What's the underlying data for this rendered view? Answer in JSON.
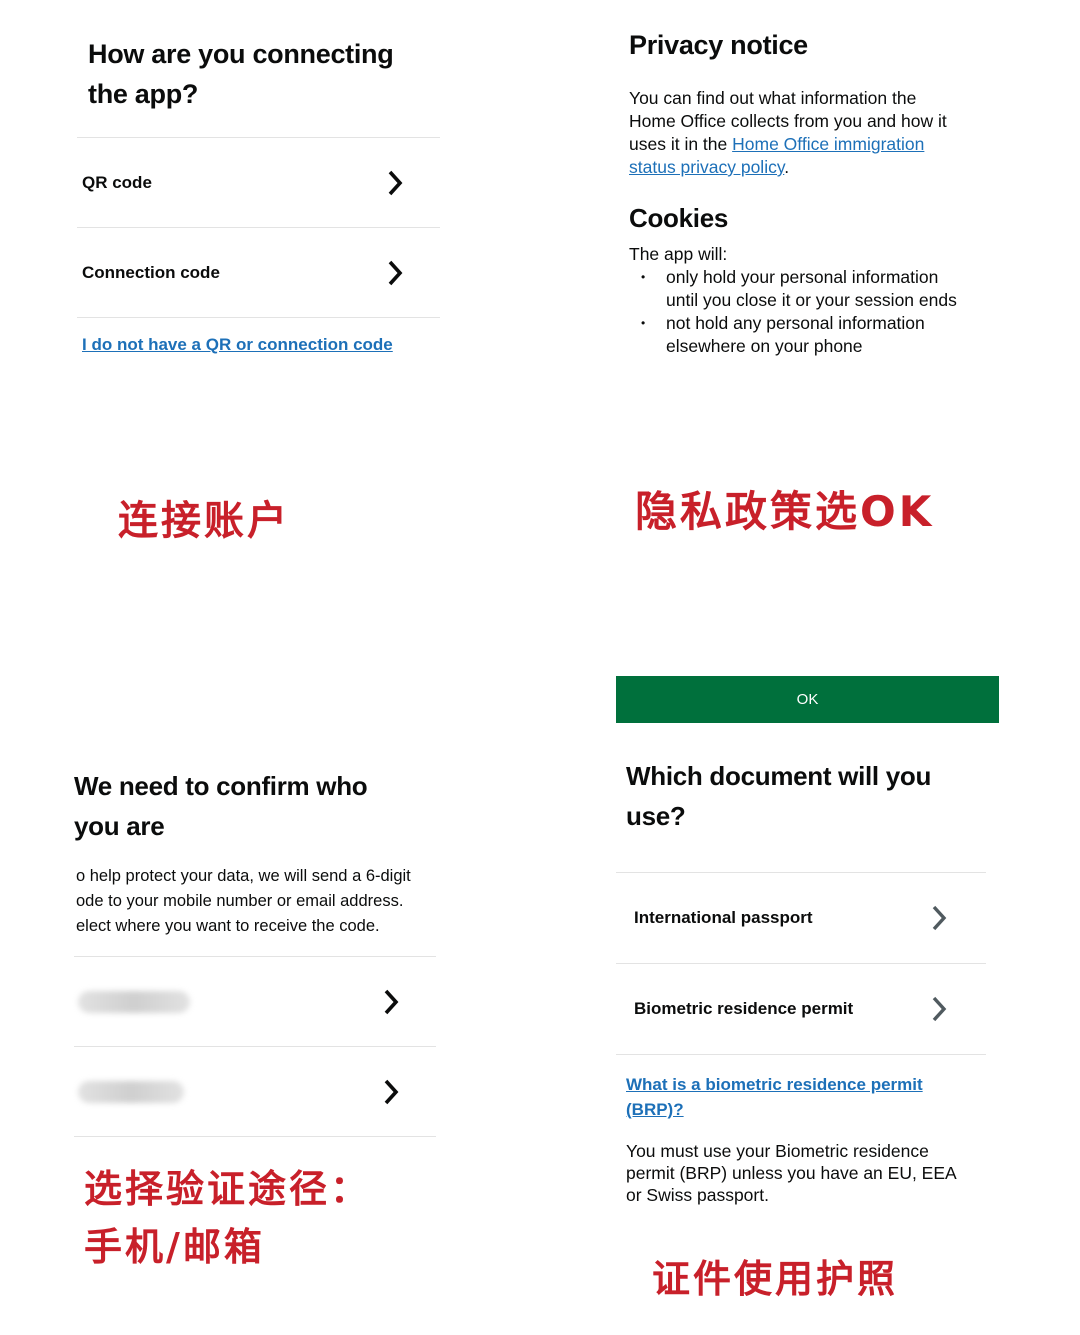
{
  "panel_connect": {
    "title_line1": "How are you connecting",
    "title_line2": "the app?",
    "options": [
      {
        "label": "QR code",
        "icon": "chevron-right-icon"
      },
      {
        "label": "Connection code",
        "icon": "chevron-right-icon"
      }
    ],
    "no_code_link": "I do not have a QR or connection code",
    "caption": "连接账户"
  },
  "panel_privacy": {
    "title": "Privacy notice",
    "text_line1": "You can find out what information the",
    "text_line2": "Home Office collects from you and how it",
    "text_line3_prefix": "uses it in the ",
    "policy_link_part1": "Home Office immigration",
    "policy_link_part2": "status privacy policy",
    "text_suffix": ".",
    "cookies_title": "Cookies",
    "cookies_intro": "The app will:",
    "cookie_points": [
      {
        "line1": "only hold your personal information",
        "line2": "until you close it or your session ends"
      },
      {
        "line1": "not hold any personal information",
        "line2": "elsewhere on your phone"
      }
    ],
    "caption": "隐私政策选OK"
  },
  "panel_confirm": {
    "title_line1": "We need to confirm who",
    "title_line2": "you are",
    "desc_line1": "o help protect your data, we will send a 6-digit",
    "desc_line2": "ode to your mobile number or email address.",
    "desc_line3": "elect where you want to receive the code.",
    "caption_line1": "选择验证途径：",
    "caption_line2": "手机/邮箱"
  },
  "panel_document": {
    "ok_label": "OK",
    "title_line1": "Which document will you",
    "title_line2": "use?",
    "options": [
      {
        "label": "International passport",
        "icon": "chevron-right-icon"
      },
      {
        "label": "Biometric residence permit",
        "icon": "chevron-right-icon"
      }
    ],
    "brp_link_line1": "What is a biometric residence permit",
    "brp_link_line2": "(BRP)?",
    "note_line1": "You must use your Biometric residence",
    "note_line2": "permit (BRP) unless you have an EU, EEA",
    "note_line3": "or Swiss passport.",
    "caption": "证件使用护照"
  },
  "colors": {
    "link": "#1d70b8",
    "ok_button": "#00703c",
    "caption": "#c8202a",
    "text": "#0b0c0c"
  }
}
